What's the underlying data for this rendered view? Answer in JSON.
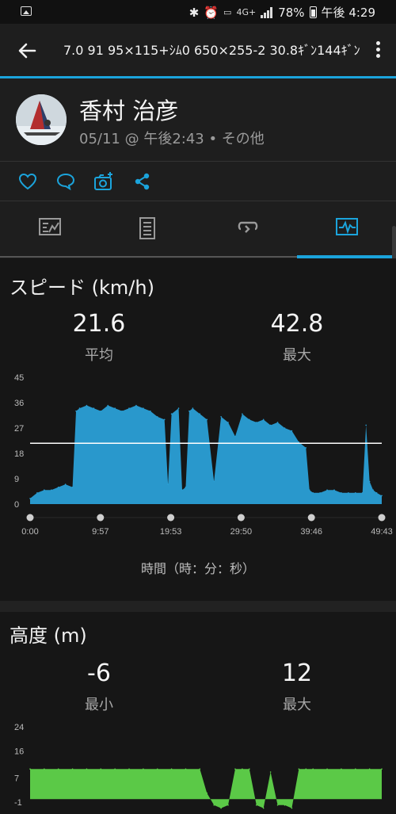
{
  "status_bar": {
    "icons": [
      "gallery-icon",
      "bluetooth-icon",
      "alarm-icon",
      "volte-icon",
      "4g-icon",
      "signal-icon",
      "battery-icon"
    ],
    "network": "4G+",
    "battery": "78%",
    "time": "午後 4:29"
  },
  "app_bar": {
    "title": "7.0 91 95×115+ｼﾑ0 650×255-2 30.8ｷﾞﾝ144ｷﾞﾝ"
  },
  "profile": {
    "name": "香村 治彦",
    "date": "05/11 @ 午後2:43 • その他"
  },
  "actions": [
    "like-icon",
    "comment-icon",
    "add-photo-icon",
    "share-icon"
  ],
  "tabs": [
    {
      "name": "summary",
      "icon": "summary-icon",
      "active": false
    },
    {
      "name": "details",
      "icon": "details-icon",
      "active": false
    },
    {
      "name": "laps",
      "icon": "laps-icon",
      "active": false
    },
    {
      "name": "charts",
      "icon": "charts-icon",
      "active": true
    }
  ],
  "colors": {
    "accent": "#1ba4dc",
    "speed_fill": "#2a9fd6",
    "elevation_fill": "#5fd34a",
    "background": "#161616",
    "panel": "#1e1e1e"
  },
  "speed": {
    "title": "スピード (km/h)",
    "avg_value": "21.6",
    "avg_label": "平均",
    "max_value": "42.8",
    "max_label": "最大",
    "x_axis_label": "時間（時：分：秒）"
  },
  "elevation": {
    "title": "高度 (m)",
    "min_value": "-6",
    "min_label": "最小",
    "max_value": "12",
    "max_label": "最大"
  },
  "chart_data": [
    {
      "type": "area",
      "y_ticks": [
        "45",
        "36",
        "27",
        "18",
        "9",
        "0"
      ],
      "ylim": [
        0,
        45
      ],
      "x_ticks": [
        "0:00",
        "9:57",
        "19:53",
        "29:50",
        "39:46",
        "49:43"
      ],
      "xlim": [
        0,
        49.72
      ],
      "average_line": 21.6,
      "max": 42.8,
      "grid": false,
      "x": [
        0,
        1,
        2,
        3,
        4,
        5,
        6,
        6.5,
        7,
        8,
        9,
        10,
        11,
        12,
        13,
        14,
        15,
        16,
        17,
        18,
        19,
        19.5,
        20,
        21,
        21.5,
        22,
        22.5,
        23,
        24,
        25,
        26,
        27,
        28,
        29,
        30,
        31,
        32,
        33,
        34,
        35,
        36,
        37,
        38,
        39,
        39.5,
        40,
        41,
        42,
        43,
        44,
        45,
        46,
        47,
        47.5,
        48,
        48.5,
        49,
        49.72
      ],
      "y": [
        2,
        4,
        5,
        5,
        6,
        7,
        6,
        33,
        34,
        35,
        34,
        33,
        35,
        34,
        33,
        34,
        35,
        34,
        33,
        31,
        30,
        7,
        32,
        34,
        5,
        6,
        33,
        34,
        32,
        30,
        8,
        31,
        29,
        24,
        32,
        30,
        29,
        30,
        28,
        29,
        27,
        26,
        22,
        20,
        5,
        4,
        4,
        5,
        5,
        4,
        4,
        4,
        4,
        28,
        8,
        5,
        4,
        3
      ],
      "units": {
        "x": "minutes",
        "y": "km/h"
      }
    },
    {
      "type": "area",
      "y_ticks": [
        "24",
        "16",
        "7",
        "-1"
      ],
      "ylim": [
        -1,
        24
      ],
      "xlim": [
        0,
        49.72
      ],
      "min": -6,
      "max": 12,
      "grid": false,
      "x": [
        0,
        2,
        4,
        6,
        8,
        10,
        12,
        14,
        16,
        18,
        20,
        22,
        24,
        25,
        26,
        27,
        28,
        29,
        30,
        31,
        32,
        33,
        34,
        35,
        36,
        37,
        38,
        39,
        40,
        42,
        44,
        46,
        48,
        49.72
      ],
      "y": [
        10,
        10,
        10,
        10,
        10,
        10,
        10,
        10,
        10,
        10,
        10,
        10,
        10,
        2,
        -2,
        -3,
        -2,
        10,
        10,
        10,
        -2,
        -3,
        9,
        -2,
        -2,
        -3,
        10,
        10,
        10,
        10,
        10,
        10,
        10,
        10
      ],
      "units": {
        "x": "minutes",
        "y": "m"
      }
    }
  ]
}
